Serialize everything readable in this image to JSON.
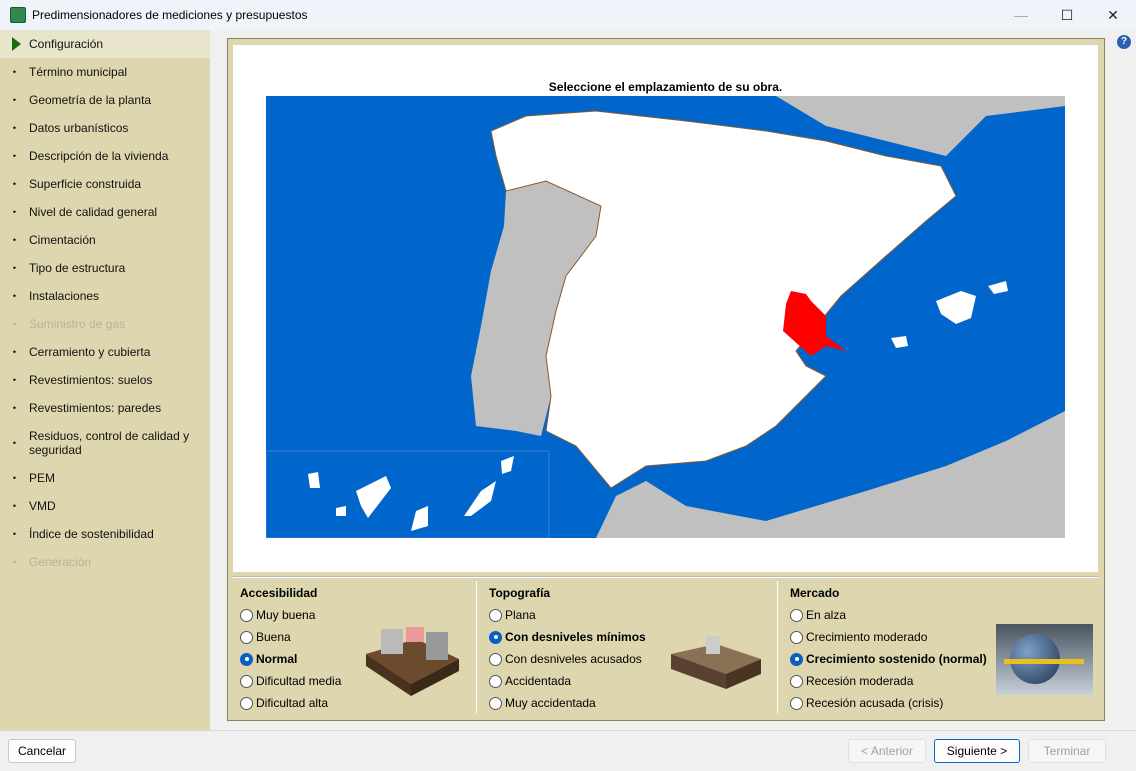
{
  "window": {
    "title": "Predimensionadores de mediciones y presupuestos",
    "minimize": "—",
    "maximize": "☐",
    "close": "✕"
  },
  "sidebar": {
    "items": [
      {
        "label": "Configuración",
        "state": "active"
      },
      {
        "label": "Término municipal",
        "state": "normal"
      },
      {
        "label": "Geometría de la planta",
        "state": "normal"
      },
      {
        "label": "Datos urbanísticos",
        "state": "normal"
      },
      {
        "label": "Descripción de la vivienda",
        "state": "normal"
      },
      {
        "label": "Superficie construida",
        "state": "normal"
      },
      {
        "label": "Nivel de calidad general",
        "state": "normal"
      },
      {
        "label": "Cimentación",
        "state": "normal"
      },
      {
        "label": "Tipo de estructura",
        "state": "normal"
      },
      {
        "label": "Instalaciones",
        "state": "normal"
      },
      {
        "label": "Suministro de gas",
        "state": "disabled"
      },
      {
        "label": "Cerramiento y cubierta",
        "state": "normal"
      },
      {
        "label": "Revestimientos: suelos",
        "state": "normal"
      },
      {
        "label": "Revestimientos: paredes",
        "state": "normal"
      },
      {
        "label": "Residuos, control de calidad y seguridad",
        "state": "normal"
      },
      {
        "label": "PEM",
        "state": "normal"
      },
      {
        "label": "VMD",
        "state": "normal"
      },
      {
        "label": "Índice de sostenibilidad",
        "state": "normal"
      },
      {
        "label": "Generación",
        "state": "disabled"
      }
    ]
  },
  "map": {
    "title": "Seleccione el emplazamiento de su obra.",
    "selected_color": "#ff0000",
    "sea_color": "#0066cc"
  },
  "help": "?",
  "groups": [
    {
      "title": "Accesibilidad",
      "options": [
        "Muy buena",
        "Buena",
        "Normal",
        "Dificultad media",
        "Dificultad alta"
      ],
      "selected": 2
    },
    {
      "title": "Topografía",
      "options": [
        "Plana",
        "Con desniveles mínimos",
        "Con desniveles acusados",
        "Accidentada",
        "Muy accidentada"
      ],
      "selected": 1
    },
    {
      "title": "Mercado",
      "options": [
        "En alza",
        "Crecimiento moderado",
        "Crecimiento sostenido (normal)",
        "Recesión moderada",
        "Recesión acusada (crisis)"
      ],
      "selected": 2
    }
  ],
  "footer": {
    "cancel": "Cancelar",
    "prev": "< Anterior",
    "next": "Siguiente >",
    "finish": "Terminar"
  }
}
